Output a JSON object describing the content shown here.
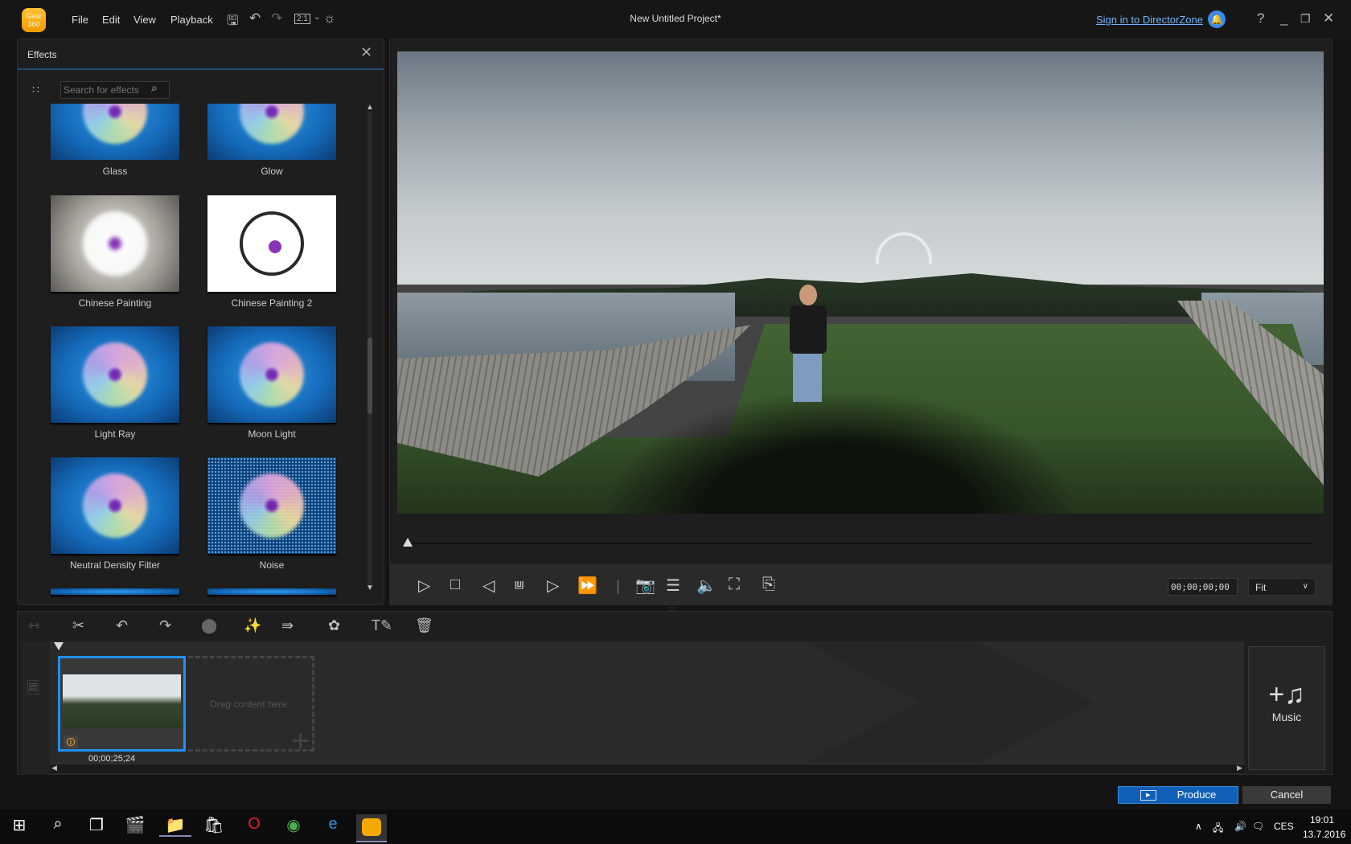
{
  "app": {
    "logo_text": "Gear 360",
    "title": "New Untitled Project*",
    "signin": "Sign in to DirectorZone"
  },
  "menu": [
    "File",
    "Edit",
    "View",
    "Playback"
  ],
  "toolbar": {
    "ratio": "2:1"
  },
  "effects": {
    "title": "Effects",
    "search_placeholder": "Search for effects",
    "items": [
      "Glass",
      "Glow",
      "Chinese Painting",
      "Chinese Painting 2",
      "Light Ray",
      "Moon Light",
      "Neutral Density Filter",
      "Noise"
    ]
  },
  "player": {
    "timecode": "00;00;00;00",
    "zoom": "Fit",
    "progress": 0
  },
  "timeline": {
    "clip_duration": "00;00;25;24",
    "drop_hint": "Drag content here",
    "music_label": "Music"
  },
  "actions": {
    "produce": "Produce",
    "cancel": "Cancel"
  },
  "taskbar": {
    "language": "CES",
    "time": "19:01",
    "date": "13.7.2016"
  },
  "colors": {
    "accent": "#1e90ff",
    "produce": "#1160b8",
    "link": "#6fb6ff"
  }
}
